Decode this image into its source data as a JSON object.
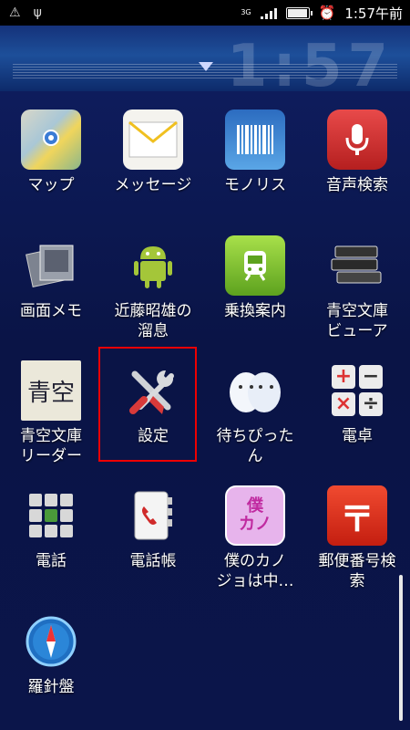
{
  "status_bar": {
    "network": "3G",
    "time": "1:57午前"
  },
  "header": {
    "clock_ghost": "1:57"
  },
  "apps": [
    {
      "label": "マップ",
      "icon": "map-icon",
      "bg": "#6aa0c8"
    },
    {
      "label": "メッセージ",
      "icon": "message-icon",
      "bg": "#f3f3ee"
    },
    {
      "label": "モノリス",
      "icon": "barcode-icon",
      "bg": "#3a82c8"
    },
    {
      "label": "音声検索",
      "icon": "microphone-icon",
      "bg": "#d93030"
    },
    {
      "label": "画面メモ",
      "icon": "screen-memo-icon",
      "bg": "#8a8f9c"
    },
    {
      "label": "近藤昭雄の\n溜息",
      "icon": "android-icon",
      "bg": "transparent"
    },
    {
      "label": "乗換案内",
      "icon": "train-icon",
      "bg": "#8ed03a"
    },
    {
      "label": "青空文庫\nビューア",
      "icon": "books-icon",
      "bg": "#cfcfcf"
    },
    {
      "label": "青空文庫\nリーダー",
      "icon": "handwriting-icon",
      "bg": "#e9e6da"
    },
    {
      "label": "設定",
      "icon": "settings-wrench-icon",
      "bg": "transparent"
    },
    {
      "label": "待ちぴった\nん",
      "icon": "ghost-character-icon",
      "bg": "transparent"
    },
    {
      "label": "電卓",
      "icon": "calculator-icon",
      "bg": "#e5e5e5"
    },
    {
      "label": "電話",
      "icon": "keypad-icon",
      "bg": "#dcdcdc"
    },
    {
      "label": "電話帳",
      "icon": "phonebook-icon",
      "bg": "#efefef"
    },
    {
      "label": "僕のカノ\nジョは中…",
      "icon": "boku-kanojo-icon",
      "bg": "#e6b3ea"
    },
    {
      "label": "郵便番号検\n索",
      "icon": "postal-icon",
      "bg": "#e23a26"
    },
    {
      "label": "羅針盤",
      "icon": "compass-icon",
      "bg": "#1f6fc2"
    }
  ],
  "icon_text": {
    "boku": "僕\nカノ",
    "postal": "〒",
    "kanji_sample": "青空"
  }
}
